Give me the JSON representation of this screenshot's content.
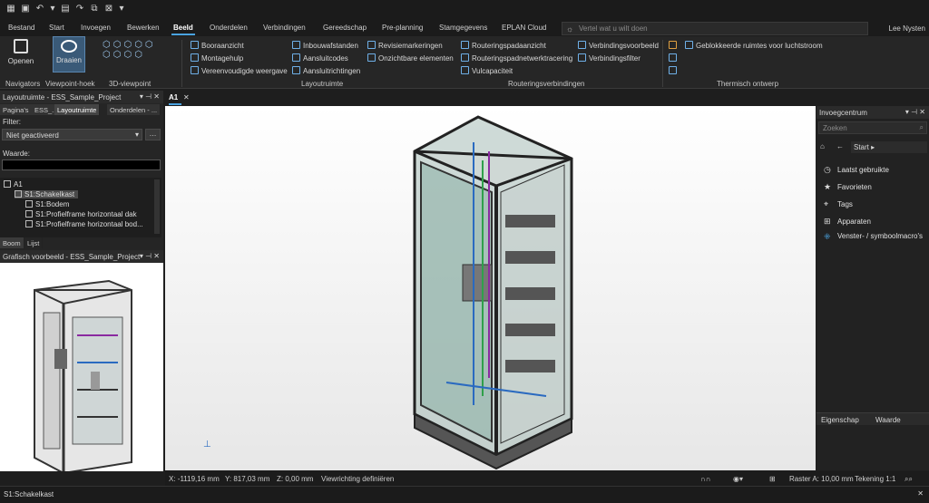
{
  "ribbon_tabs": [
    "Bestand",
    "Start",
    "Invoegen",
    "Bewerken",
    "Beeld",
    "Onderdelen",
    "Verbindingen",
    "Gereedschap",
    "Pre-planning",
    "Stamgegevens",
    "EPLAN Cloud"
  ],
  "search_placeholder": "Vertel wat u wilt doen",
  "user": "Lee Nysten",
  "ribbon": {
    "open": "Openen",
    "rotate": "Draaien",
    "group_navigators": "Navigators",
    "group_viewpoint": "Viewpoint-hoek",
    "group_3d": "3D-viewpoint",
    "col1": [
      "Booraanzicht",
      "Montagehulp",
      "Vereenvoudigde weergave"
    ],
    "col2": [
      "Inbouwafstanden",
      "Aansluitcodes",
      "Aansluitrichtingen"
    ],
    "group_layout": "Layoutruimte",
    "col3": [
      "Revisiemarkeringen",
      "Onzichtbare elementen"
    ],
    "col4": [
      "Routeringspadaanzicht",
      "Routeringspadnetwerktracering",
      "Vulcapaciteit"
    ],
    "group_routing": "Routeringsverbindingen",
    "col5": [
      "Verbindingsvoorbeeld",
      "Verbindingsfilter"
    ],
    "blocked": "Geblokkeerde ruimtes voor luchtstroom",
    "group_thermal": "Thermisch ontwerp"
  },
  "left": {
    "title": "Layoutruimte - ESS_Sample_Project",
    "subtabs": [
      "Pagina's",
      "ESS_...",
      "Layoutruimte",
      "Onderdelen - ..."
    ],
    "filter_label": "Filter:",
    "filter_value": "Niet geactiveerd",
    "value_label": "Waarde:",
    "tree": [
      "A1",
      "S1:Schakelkast",
      "S1:Bodem",
      "S1:Profielframe horizontaal dak",
      "S1:Profielframe horizontaal bod..."
    ],
    "tree_tabs": [
      "Boom",
      "Lijst"
    ],
    "preview_title": "Grafisch voorbeeld - ESS_Sample_Project"
  },
  "doc_tab": "A1",
  "right": {
    "title": "Invoegcentrum",
    "search_placeholder": "Zoeken",
    "crumb": "Start",
    "items": [
      "Laatst gebruikte",
      "Favorieten",
      "Tags",
      "Apparaten",
      "Venster- / symboolmacro's"
    ],
    "icons": [
      "clock-icon",
      "star-icon",
      "tag-icon",
      "cart-icon",
      "macro-icon"
    ],
    "prop_col1": "Eigenschap",
    "prop_col2": "Waarde"
  },
  "status": {
    "x": "X: -1119,16 mm",
    "y": "Y: 817,03 mm",
    "z": "Z: 0,00 mm",
    "dir": "Viewrichting definiëren",
    "raster": "Raster A: 10,00 mm",
    "drawing": "Tekening 1:1"
  },
  "bottom_label": "S1:Schakelkast",
  "colors": {
    "accent": "#4aa3e0",
    "background": "#1e1e1e",
    "panel": "#252525"
  }
}
